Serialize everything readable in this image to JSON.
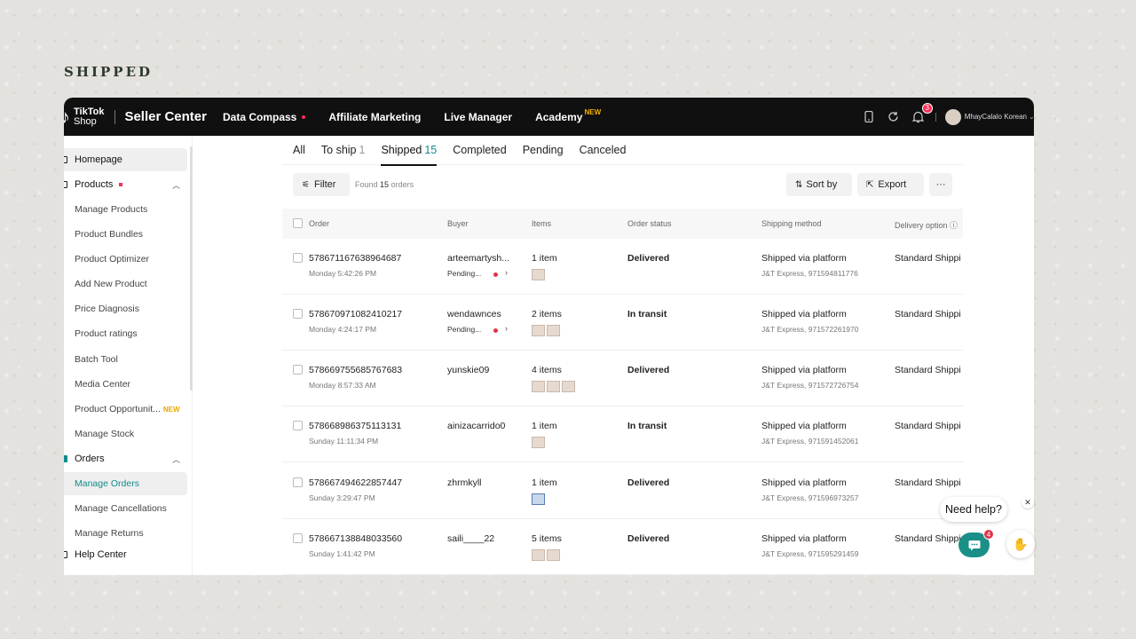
{
  "slide_title": "SHIPPED",
  "header": {
    "logo_line1": "TikTok",
    "logo_line2": "Shop",
    "app_name": "Seller Center",
    "nav": [
      {
        "label": "Data Compass"
      },
      {
        "label": "Affiliate Marketing"
      },
      {
        "label": "Live Manager"
      },
      {
        "label": "Academy",
        "badge": "NEW"
      }
    ],
    "notifications": "3",
    "user": "MhayCalalo Korean"
  },
  "sidebar": {
    "items": [
      {
        "label": "Homepage"
      },
      {
        "label": "Products"
      },
      {
        "label": "Manage Products"
      },
      {
        "label": "Product Bundles"
      },
      {
        "label": "Product Optimizer"
      },
      {
        "label": "Add New Product"
      },
      {
        "label": "Price Diagnosis"
      },
      {
        "label": "Product ratings"
      },
      {
        "label": "Batch Tool"
      },
      {
        "label": "Media Center"
      },
      {
        "label": "Product Opportunit...",
        "badge": "NEW"
      },
      {
        "label": "Manage Stock"
      },
      {
        "label": "Orders"
      },
      {
        "label": "Manage Orders"
      },
      {
        "label": "Manage Cancellations"
      },
      {
        "label": "Manage Returns"
      },
      {
        "label": "Help Center"
      }
    ]
  },
  "tabs": [
    {
      "label": "All",
      "count": ""
    },
    {
      "label": "To ship",
      "count": "1"
    },
    {
      "label": "Shipped",
      "count": "15"
    },
    {
      "label": "Completed",
      "count": ""
    },
    {
      "label": "Pending",
      "count": ""
    },
    {
      "label": "Canceled",
      "count": ""
    }
  ],
  "toolbar": {
    "filter": "Filter",
    "found_prefix": "Found",
    "found_count": "15",
    "found_suffix": "orders",
    "sort": "Sort by",
    "export": "Export",
    "more": "···"
  },
  "table": {
    "headers": [
      "Order",
      "Buyer",
      "Items",
      "Order status",
      "Shipping method",
      "Delivery option"
    ],
    "rows": [
      {
        "order": "578671167638964687",
        "time": "Monday 5:42:26 PM",
        "buyer": "arteemartysh...",
        "pending": "Pending...",
        "items": "1 item",
        "thumbs": 1,
        "status": "Delivered",
        "ship": "Shipped via platform",
        "tracking": "J&T Express, 971594811776",
        "delivery": "Standard Shippi"
      },
      {
        "order": "578670971082410217",
        "time": "Monday 4:24:17 PM",
        "buyer": "wendawnces",
        "pending": "Pending...",
        "items": "2 items",
        "thumbs": 2,
        "status": "In transit",
        "ship": "Shipped via platform",
        "tracking": "J&T Express, 971572261970",
        "delivery": "Standard Shippi"
      },
      {
        "order": "578669755685767683",
        "time": "Monday 8:57:33 AM",
        "buyer": "yunskie09",
        "pending": "",
        "items": "4 items",
        "thumbs": 3,
        "status": "Delivered",
        "ship": "Shipped via platform",
        "tracking": "J&T Express, 971572726754",
        "delivery": "Standard Shippi"
      },
      {
        "order": "578668986375113131",
        "time": "Sunday 11:11:34 PM",
        "buyer": "ainizacarrido0",
        "pending": "",
        "items": "1 item",
        "thumbs": 1,
        "status": "In transit",
        "ship": "Shipped via platform",
        "tracking": "J&T Express, 971591452061",
        "delivery": "Standard Shippi"
      },
      {
        "order": "578667494622857447",
        "time": "Sunday 3:29:47 PM",
        "buyer": "zhrmkyll",
        "pending": "",
        "items": "1 item",
        "thumbs": 1,
        "status": "Delivered",
        "ship": "Shipped via platform",
        "tracking": "J&T Express, 971596973257",
        "delivery": "Standard Shippi"
      },
      {
        "order": "578667138848033560",
        "time": "Sunday 1:41:42 PM",
        "buyer": "saili____22",
        "pending": "",
        "items": "5 items",
        "thumbs": 2,
        "status": "Delivered",
        "ship": "Shipped via platform",
        "tracking": "J&T Express, 971595291459",
        "delivery": "Standard Shippi"
      }
    ]
  },
  "help": {
    "label": "Need help?",
    "chat_badge": "4"
  }
}
